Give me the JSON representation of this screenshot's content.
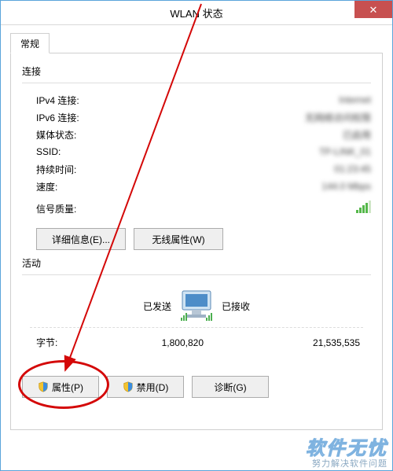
{
  "window": {
    "title": "WLAN 状态"
  },
  "tabs": {
    "general": "常规"
  },
  "conn": {
    "header": "连接",
    "rows": {
      "ipv4": {
        "k": "IPv4 连接:",
        "v": "Internet"
      },
      "ipv6": {
        "k": "IPv6 连接:",
        "v": "无网络访问权限"
      },
      "media": {
        "k": "媒体状态:",
        "v": "已启用"
      },
      "ssid": {
        "k": "SSID:",
        "v": "TP-LINK_01"
      },
      "dur": {
        "k": "持续时间:",
        "v": "01:23:45"
      },
      "speed": {
        "k": "速度:",
        "v": "144.0 Mbps"
      },
      "signal": {
        "k": "信号质量:"
      }
    },
    "buttons": {
      "details": "详细信息(E)...",
      "wireless": "无线属性(W)"
    }
  },
  "activity": {
    "header": "活动",
    "sent": "已发送",
    "recv": "已接收",
    "bytes_label": "字节:",
    "sent_val": "1,800,820",
    "recv_val": "21,535,535"
  },
  "footer_buttons": {
    "props": "属性(P)",
    "disable": "禁用(D)",
    "diag": "诊断(G)"
  },
  "brand": {
    "name": "软件无忧",
    "slogan": "努力解决软件问题"
  }
}
